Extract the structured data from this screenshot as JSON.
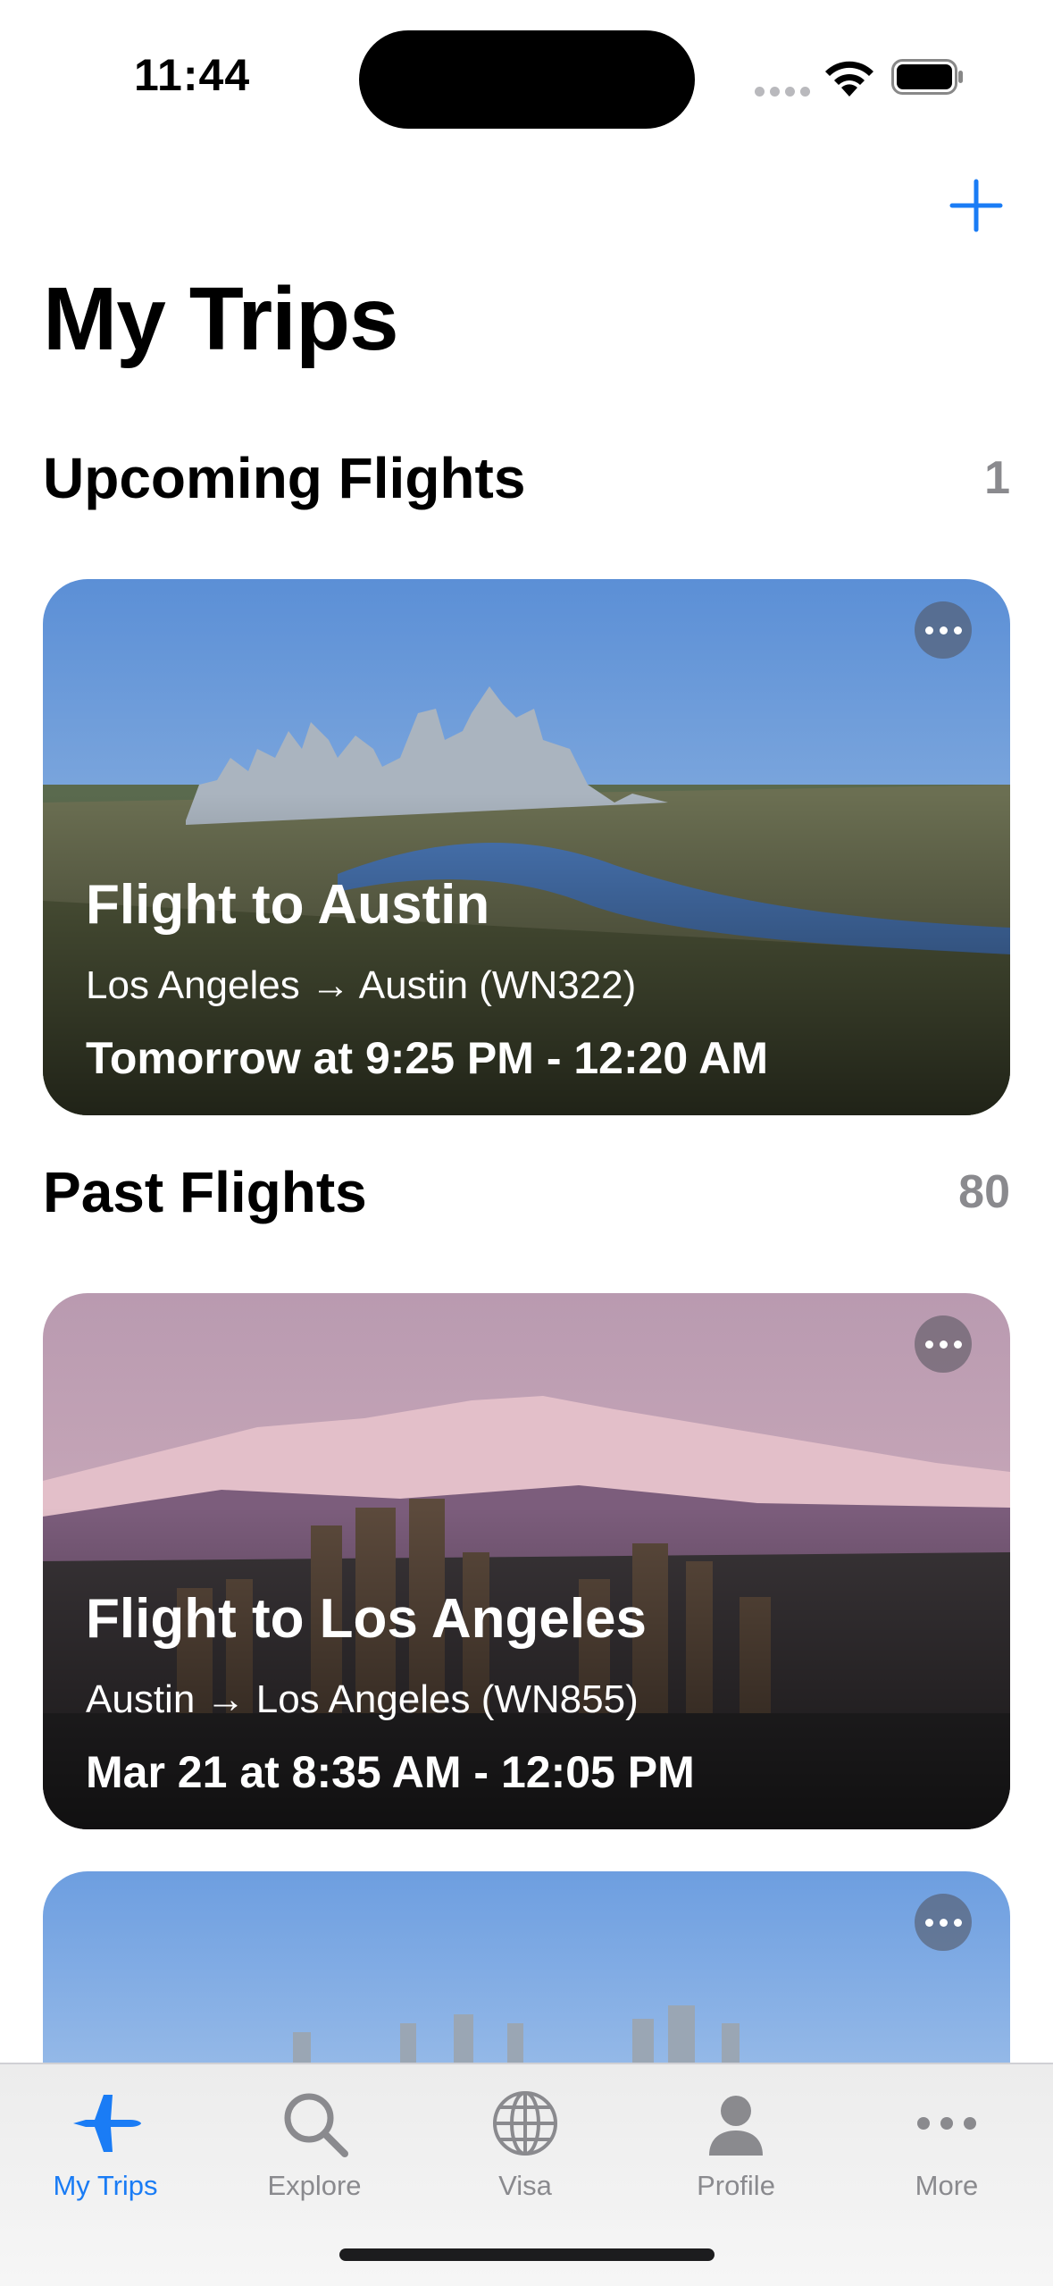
{
  "status_bar": {
    "time": "11:44"
  },
  "header": {
    "title": "My Trips",
    "add_icon": "plus-icon"
  },
  "sections": [
    {
      "title": "Upcoming Flights",
      "count": "1"
    },
    {
      "title": "Past Flights",
      "count": "80"
    }
  ],
  "cards": [
    {
      "title": "Flight to Austin",
      "route": "Los Angeles → Austin (WN322)",
      "time": "Tomorrow at 9:25 PM - 12:20 AM"
    },
    {
      "title": "Flight to Los Angeles",
      "route": "Austin → Los Angeles (WN855)",
      "time": "Mar 21 at 8:35 AM - 12:05 PM"
    }
  ],
  "tabs": [
    {
      "label": "My Trips",
      "icon": "airplane-icon",
      "active": true
    },
    {
      "label": "Explore",
      "icon": "search-icon"
    },
    {
      "label": "Visa",
      "icon": "globe-icon"
    },
    {
      "label": "Profile",
      "icon": "person-icon"
    },
    {
      "label": "More",
      "icon": "ellipsis-icon"
    }
  ],
  "colors": {
    "accent": "#1a7cf5",
    "secondary_text": "#8a8a8e"
  }
}
